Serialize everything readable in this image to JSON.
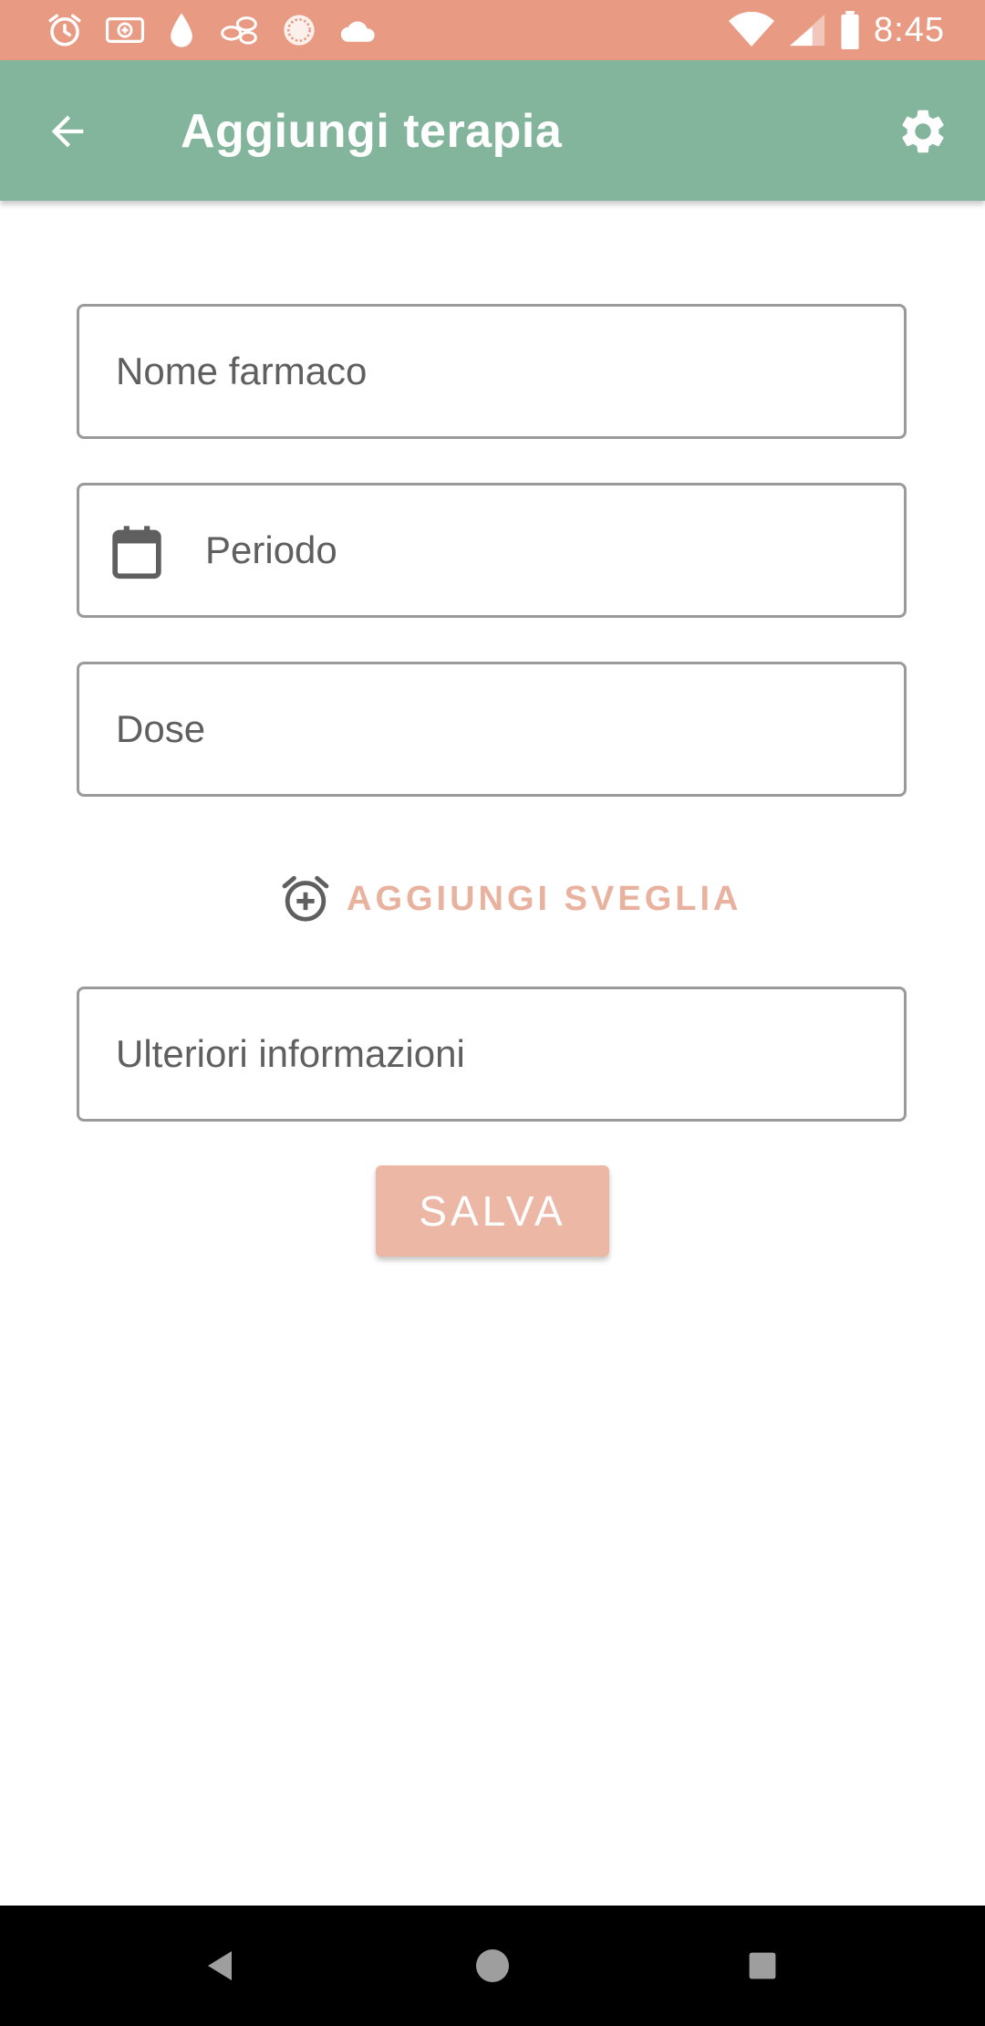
{
  "status_bar": {
    "time": "8:45",
    "notification_icons": [
      "alarm-icon",
      "medical-card-icon",
      "drop-icon",
      "pills-icon",
      "dotted-circle-icon",
      "cloud-icon"
    ],
    "system_icons": [
      "wifi-icon",
      "signal-icon",
      "battery-icon"
    ],
    "background_color": "#e89a83"
  },
  "app_bar": {
    "title": "Aggiungi terapia",
    "back_icon": "arrow-left-icon",
    "settings_icon": "gear-icon",
    "background_color": "#83b49c"
  },
  "form": {
    "drug_name": {
      "placeholder": "Nome farmaco",
      "value": ""
    },
    "period": {
      "placeholder": "Periodo",
      "value": "",
      "icon": "calendar-icon"
    },
    "dose": {
      "placeholder": "Dose",
      "value": ""
    },
    "add_alarm": {
      "label": "AGGIUNGI SVEGLIA",
      "icon": "alarm-add-icon",
      "color": "#e9b29f"
    },
    "more_info": {
      "placeholder": "Ulteriori informazioni",
      "value": ""
    },
    "save": {
      "label": "SALVA",
      "color": "#ecb7a4"
    }
  },
  "nav_bar": {
    "buttons": [
      "back-triangle-icon",
      "home-circle-icon",
      "recents-square-icon"
    ]
  }
}
